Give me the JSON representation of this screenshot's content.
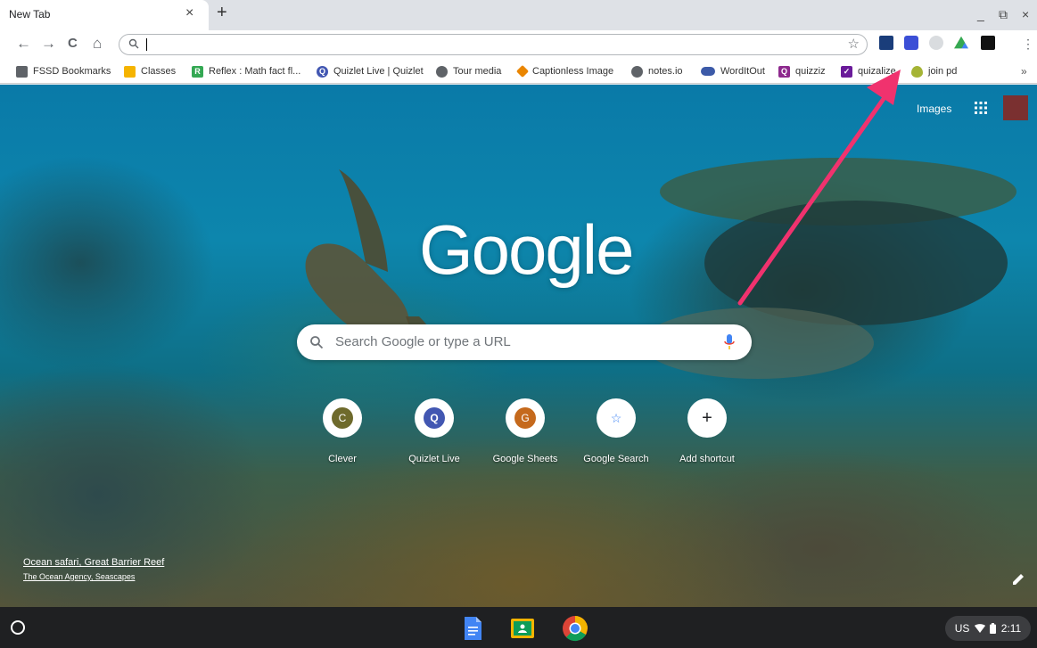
{
  "tab": {
    "title": "New Tab",
    "close": "×"
  },
  "newtab": "+",
  "window": {
    "minimize": "_",
    "restore": "⧉",
    "close": "×"
  },
  "toolbar": {
    "back": "←",
    "forward": "→",
    "reload": "C",
    "home": "⌂",
    "star": "☆",
    "menu": "⋮"
  },
  "omnibox": {
    "value": ""
  },
  "bookmarks": [
    {
      "label": "FSSD Bookmarks",
      "color": "#5f6368"
    },
    {
      "label": "Classes",
      "color": "#f5b400"
    },
    {
      "label": "Reflex : Math fact fl...",
      "color": "#34a853"
    },
    {
      "label": "Quizlet Live | Quizlet",
      "color": "#4257b2"
    },
    {
      "label": "Tour media",
      "color": "#5f6368"
    },
    {
      "label": "Captionless Image",
      "color": "#ea8600"
    },
    {
      "label": "notes.io",
      "color": "#5f6368"
    },
    {
      "label": "WordItOut",
      "color": "#3c5aa8"
    },
    {
      "label": "quizziz",
      "color": "#8e2a8e"
    },
    {
      "label": "quizalize",
      "color": "#6a1b9a"
    },
    {
      "label": "join pd",
      "color": "#a5b435"
    }
  ],
  "bookmarks_more": "»",
  "header": {
    "images": "Images"
  },
  "logo": "Google",
  "search": {
    "placeholder": "Search Google or type a URL"
  },
  "shortcuts": [
    {
      "label": "Clever",
      "letter": "C",
      "color": "#6e6a2c"
    },
    {
      "label": "Quizlet Live",
      "letter": "Q",
      "color": "#4257b2"
    },
    {
      "label": "Google Sheets",
      "letter": "G",
      "color": "#c5691c"
    },
    {
      "label": "Google Search",
      "letter": "☆",
      "color": "#ffffff"
    },
    {
      "label": "Add shortcut",
      "letter": "+",
      "color": "#ffffff"
    }
  ],
  "attribution": {
    "title": "Ocean safari, Great Barrier Reef",
    "author": "The Ocean Agency, Seascapes"
  },
  "status": {
    "locale": "US",
    "time": "2:11"
  }
}
